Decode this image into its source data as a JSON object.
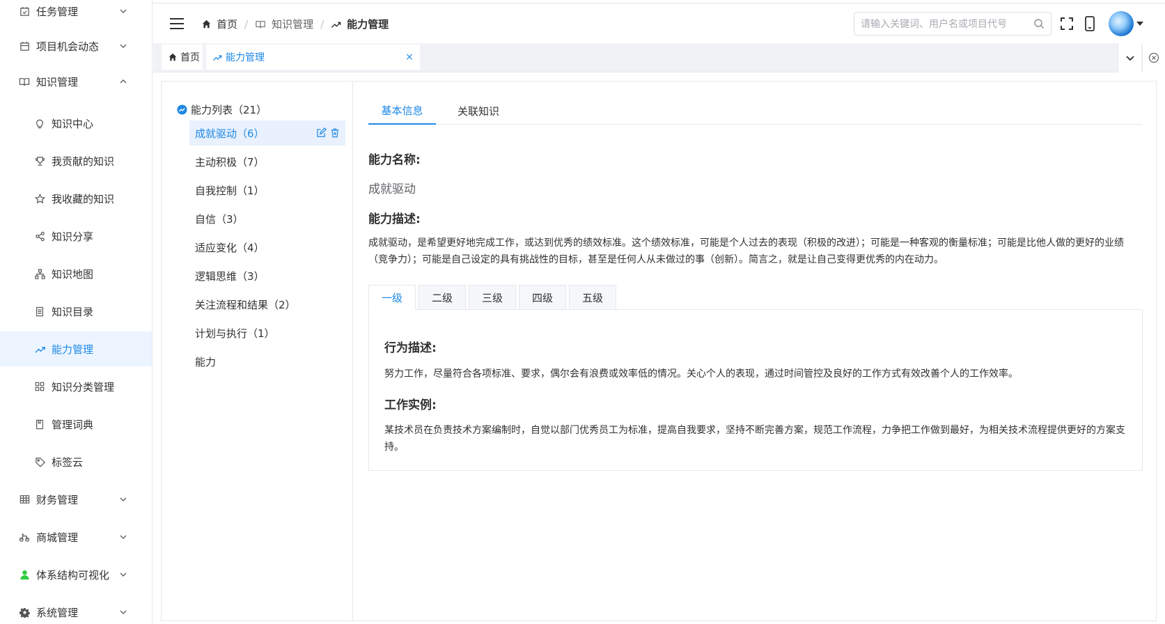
{
  "sidebar": {
    "items": [
      {
        "label": "任务管理",
        "icon": "calendar-check-icon",
        "expandable": true
      },
      {
        "label": "项目机会动态",
        "icon": "calendar-icon",
        "expandable": true
      },
      {
        "label": "知识管理",
        "icon": "book-icon",
        "expandable": true,
        "expanded": true
      },
      {
        "label": "知识中心",
        "icon": "lightbulb-icon"
      },
      {
        "label": "我贡献的知识",
        "icon": "trophy-icon"
      },
      {
        "label": "我收藏的知识",
        "icon": "star-icon"
      },
      {
        "label": "知识分享",
        "icon": "share-icon"
      },
      {
        "label": "知识地图",
        "icon": "org-chart-icon"
      },
      {
        "label": "知识目录",
        "icon": "list-icon"
      },
      {
        "label": "能力管理",
        "icon": "trend-icon",
        "active": true
      },
      {
        "label": "知识分类管理",
        "icon": "grid-icon"
      },
      {
        "label": "管理词典",
        "icon": "dictionary-icon"
      },
      {
        "label": "标签云",
        "icon": "tag-icon"
      },
      {
        "label": "财务管理",
        "icon": "table-icon",
        "expandable": true
      },
      {
        "label": "商城管理",
        "icon": "bike-icon",
        "expandable": true
      },
      {
        "label": "体系结构可视化",
        "icon": "person-icon",
        "expandable": true
      },
      {
        "label": "系统管理",
        "icon": "gear-icon",
        "expandable": true
      }
    ]
  },
  "header": {
    "breadcrumb": {
      "home": "首页",
      "section": "知识管理",
      "current": "能力管理"
    },
    "search_placeholder": "请输入关键词、用户名或项目代号"
  },
  "tags": {
    "home": "首页",
    "current": "能力管理"
  },
  "tree": {
    "root": "能力列表（21）",
    "nodes": [
      "成就驱动（6）",
      "主动积极（7）",
      "自我控制（1）",
      "自信（3）",
      "适应变化（4）",
      "逻辑思维（3）",
      "关注流程和结果（2）",
      "计划与执行（1）",
      "能力"
    ]
  },
  "detail": {
    "tabs": [
      "基本信息",
      "关联知识"
    ],
    "name_label": "能力名称:",
    "name_value": "成就驱动",
    "desc_label": "能力描述:",
    "desc_value": "成就驱动，是希望更好地完成工作，或达到优秀的绩效标准。这个绩效标准，可能是个人过去的表现（积极的改进）；可能是一种客观的衡量标准；可能是比他人做的更好的业绩（竞争力）；可能是自己设定的具有挑战性的目标，甚至是任何人从未做过的事（创新）。简言之，就是让自己变得更优秀的内在动力。",
    "levels": [
      "一级",
      "二级",
      "三级",
      "四级",
      "五级"
    ],
    "behavior_label": "行为描述:",
    "behavior_value": "努力工作，尽量符合各项标准、要求，偶尔会有浪费或效率低的情况。关心个人的表现，通过时间管控及良好的工作方式有效改善个人的工作效率。",
    "example_label": "工作实例:",
    "example_value": "某技术员在负责技术方案编制时，自觉以部门优秀员工为标准，提高自我要求，坚持不断完善方案，规范工作流程，力争把工作做到最好，为相关技术流程提供更好的方案支持。"
  },
  "colors": {
    "accent": "#1e88e5",
    "active_bg": "#ecf5ff",
    "border": "#e4e7ed"
  }
}
